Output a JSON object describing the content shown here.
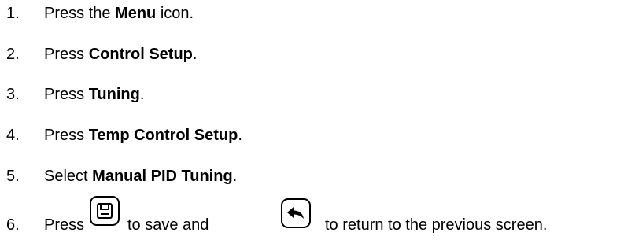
{
  "steps": [
    {
      "number": "1.",
      "pre": "Press the ",
      "bold": "Menu",
      "post": " icon."
    },
    {
      "number": "2.",
      "pre": "Press ",
      "bold": "Control Setup",
      "post": "."
    },
    {
      "number": "3.",
      "pre": "Press ",
      "bold": "Tuning",
      "post": "."
    },
    {
      "number": "4.",
      "pre": "Press ",
      "bold": "Temp Control Setup",
      "post": "."
    },
    {
      "number": "5.",
      "pre": "Select ",
      "bold": "Manual PID Tuning",
      "post": "."
    },
    {
      "number": "6.",
      "pre": "Press",
      "mid": "to save and",
      "post": "to return to the previous screen."
    }
  ],
  "icons": {
    "save": "save-icon",
    "back": "return-arrow-icon"
  }
}
